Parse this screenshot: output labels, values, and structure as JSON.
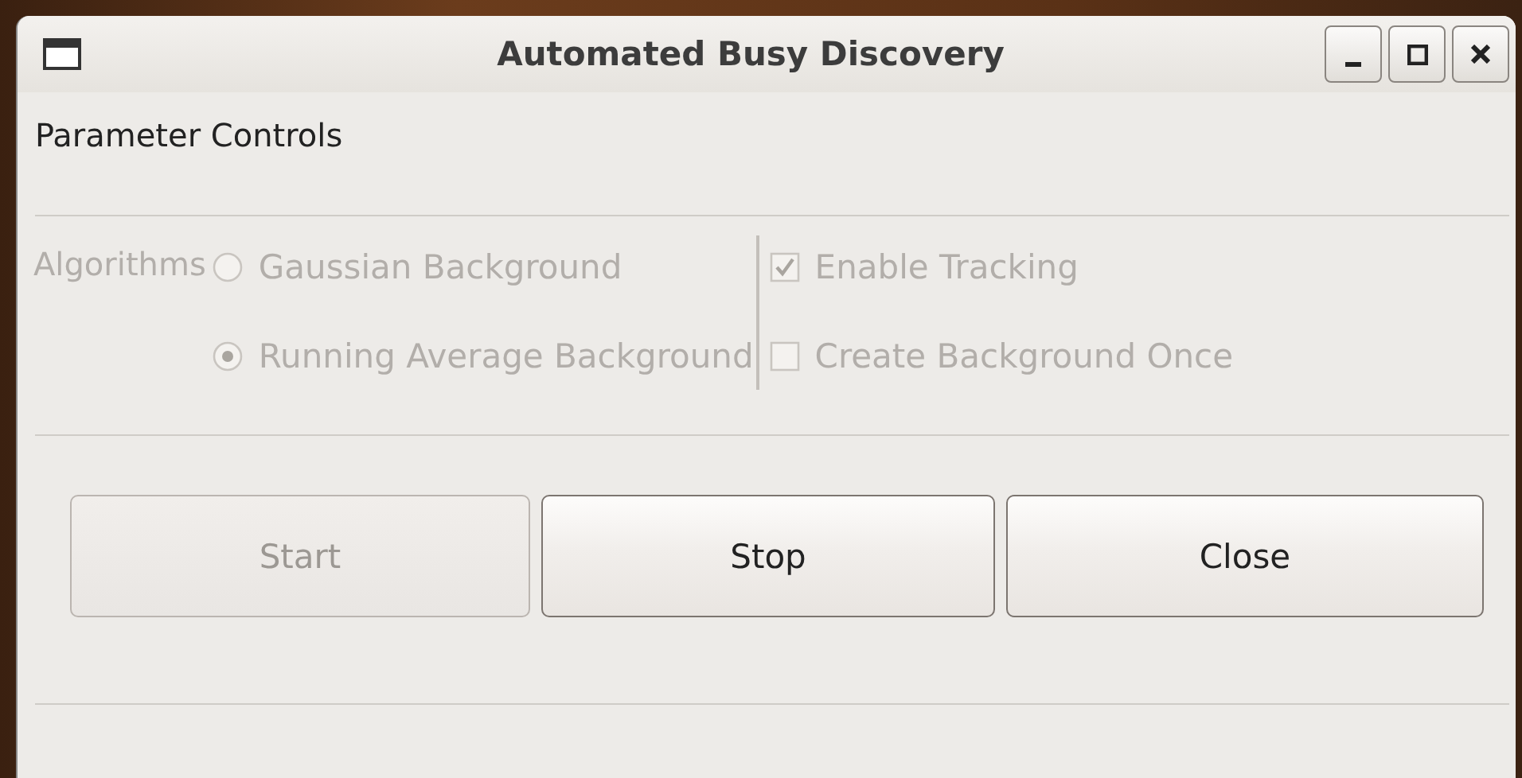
{
  "window": {
    "title": "Automated Busy Discovery",
    "controls": [
      {
        "kind": "minimize"
      },
      {
        "kind": "maximize"
      },
      {
        "kind": "close"
      }
    ]
  },
  "section_label": "Parameter Controls",
  "algorithms": {
    "label": "Algorithms",
    "disabled": true,
    "options": [
      {
        "label": "Gaussian Background",
        "selected": false
      },
      {
        "label": "Running Average Background",
        "selected": true
      }
    ]
  },
  "checkboxes": [
    {
      "label": "Enable Tracking",
      "checked": true,
      "disabled": true
    },
    {
      "label": "Create Background Once",
      "checked": false,
      "disabled": true
    }
  ],
  "buttons": [
    {
      "label": "Start",
      "disabled": true
    },
    {
      "label": "Stop",
      "disabled": false
    },
    {
      "label": "Close",
      "disabled": false
    }
  ]
}
